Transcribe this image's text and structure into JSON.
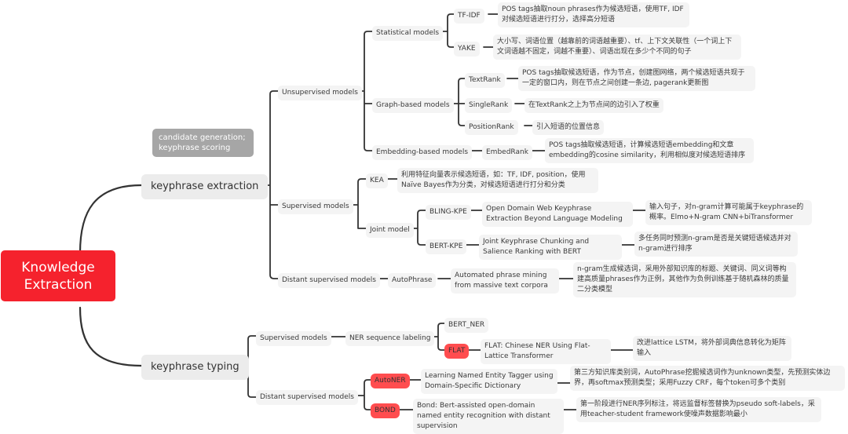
{
  "root": {
    "label": "Knowledge Extraction",
    "color": "#f5222d"
  },
  "note": {
    "label": "candidate generation; keyphrase scoring"
  },
  "branches": {
    "extraction": {
      "label": "keyphrase extraction",
      "unsupervised": {
        "label": "Unsupervised models",
        "statistical": {
          "label": "Statistical models",
          "tfidf": {
            "label": "TF-IDF",
            "desc": "POS tags抽取noun phrases作为候选短语，使用TF, IDF 对候选短语进行打分，选择高分短语"
          },
          "yake": {
            "label": "YAKE",
            "desc": "大小写、词语位置（越靠前的词语越重要）、tf、上下文关联性（一个词上下文词语越不固定，词越不重要）、词语出现在多少个不同的句子"
          }
        },
        "graph": {
          "label": "Graph-based models",
          "textrank": {
            "label": "TextRank",
            "desc": "POS tags抽取候选短语，作为节点，创建图网络，两个候选短语共现于一定的窗口内，则在节点之间创建一条边, pagerank更新图"
          },
          "singlerank": {
            "label": "SingleRank",
            "desc": "在TextRank之上为节点间的边引入了权重"
          },
          "positionrank": {
            "label": "PositionRank",
            "desc": "引入短语的位置信息"
          }
        },
        "embedding": {
          "label": "Embedding-based models",
          "embedrank": {
            "label": "EmbedRank",
            "desc": "POS tags抽取候选短语，计算候选短语embedding和文章embedding的cosine similarity，利用相似度对候选短语排序"
          }
        }
      },
      "supervised": {
        "label": "Supervised models",
        "kea": {
          "label": "KEA",
          "desc": "利用特征向量表示候选短语，如：TF, IDF, position，使用Naïve Bayes作为分类，对候选短语进行打分和分类"
        },
        "joint": {
          "label": "Joint model",
          "bling": {
            "label": "BLING-KPE",
            "paper": "Open Domain Web Keyphrase Extraction Beyond Language Modeling",
            "desc": "输入句子，对n-gram计算可能属于keyphrase的概率。Elmo+N-gram CNN+biTransformer"
          },
          "bert": {
            "label": "BERT-KPE",
            "paper": "Joint Keyphrase Chunking and Salience Ranking with BERT",
            "desc": "多任务同时预测n-gram是否是关键短语候选并对n-gram进行排序"
          }
        }
      },
      "distant": {
        "label": "Distant supervised models",
        "autophrase": {
          "label": "AutoPhrase",
          "paper": "Automated phrase mining from massive text corpora",
          "desc": "n-gram生成候选词，采用外部知识库的标题、关键词、同义词等构建高质量phrases作为正例，其他作为负例训练基于随机森林的质量二分类模型"
        }
      }
    },
    "typing": {
      "label": "keyphrase typing",
      "supervised": {
        "label": "Supervised models",
        "ner": {
          "label": "NER sequence labeling",
          "bertner": {
            "label": "BERT_NER"
          },
          "flat": {
            "label": "FLAT",
            "paper": "FLAT: Chinese NER Using Flat-Lattice Transformer",
            "desc": "改进lattice LSTM，将外部词典信息转化为矩阵输入"
          }
        }
      },
      "distant": {
        "label": "Distant supervised models",
        "autoner": {
          "label": "AutoNER",
          "paper": "Learning Named Entity Tagger using Domain-Specific Dictionary",
          "desc": "第三方知识库类别词，AutoPhrase挖掘候选词作为unknown类型，先预测实体边界，再softmax预测类型；采用Fuzzy CRF，每个token可多个类别"
        },
        "bond": {
          "label": "BOND",
          "paper": "Bond: Bert-assisted open-domain named entity recognition with distant supervision",
          "desc": "第一阶段进行NER序列标注，将远监督标签替换为pseudo soft-labels，采用teacher-student framework使噪声数据影响最小"
        }
      }
    }
  },
  "colors": {
    "highlight": "#ff4d4f",
    "line": "#333333",
    "node_bg": "#f4f4f4"
  }
}
